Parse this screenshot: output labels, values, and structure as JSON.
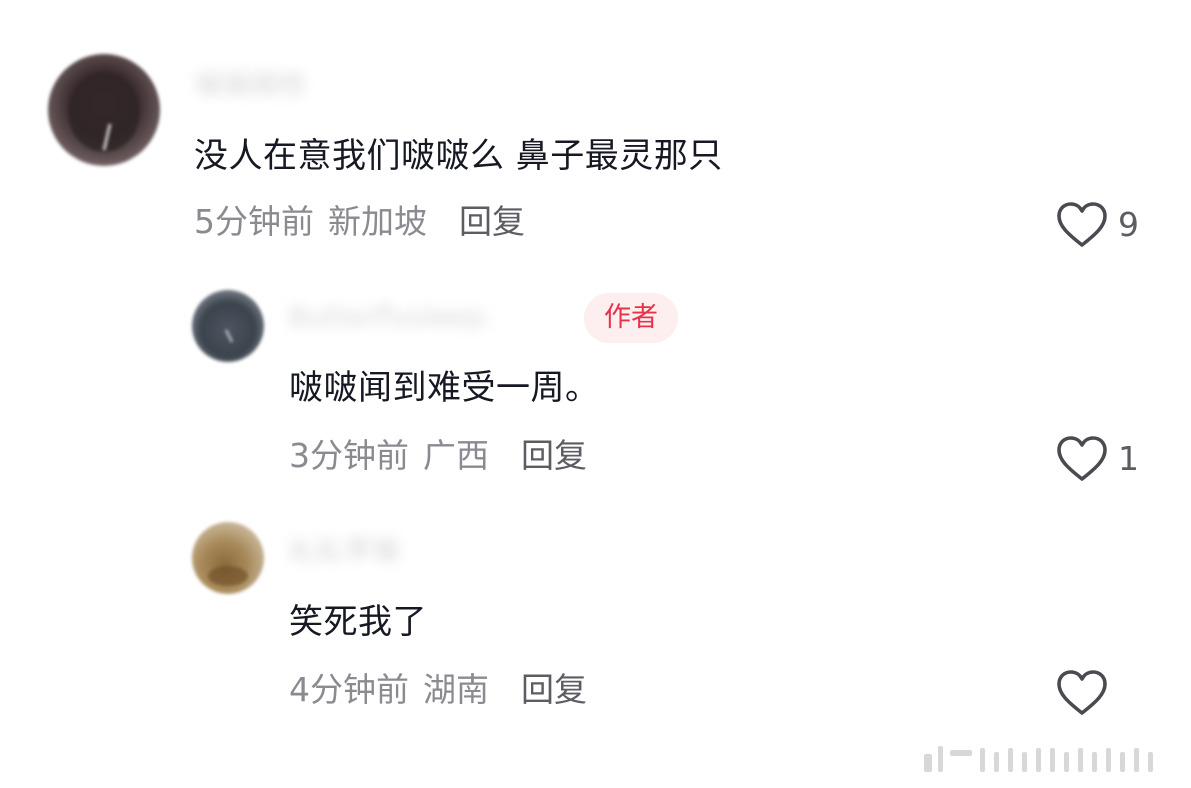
{
  "comments": [
    {
      "username": "猫猫踏枝_",
      "text": "没人在意我们啵啵么 鼻子最灵那只",
      "time": "5分钟前",
      "location": "新加坡",
      "reply_label": "回复",
      "likes": "9",
      "is_author": false
    },
    {
      "username": "Butterflysleep.",
      "text": "啵啵闻到难受一周。",
      "time": "3分钟前",
      "location": "广西",
      "reply_label": "回复",
      "likes": "1",
      "is_author": true,
      "author_badge": "作者"
    },
    {
      "username": "乱乱李猫",
      "text": "笑死我了",
      "time": "4分钟前",
      "location": "湖南",
      "reply_label": "回复",
      "likes": "",
      "is_author": false
    }
  ],
  "icons": {
    "like": "heart-outline-icon"
  },
  "colors": {
    "text": "#161823",
    "meta": "#8a8b91",
    "reply": "#5c5d63",
    "author_badge_text": "#e8324a",
    "author_badge_bg": "#fdeef0",
    "background": "#ffffff"
  }
}
